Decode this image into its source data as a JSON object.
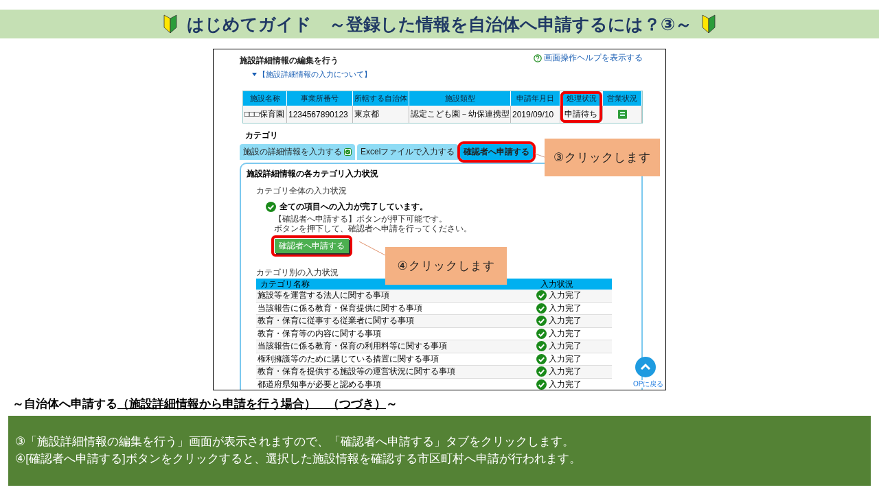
{
  "title": {
    "text": "はじめてガイド　～登録した情報を自治体へ申請するには？③～"
  },
  "screenshot": {
    "page_title": "施設詳細情報の編集を行う",
    "help_link": "画面操作ヘルプを表示する",
    "info_toggle": "【施設詳細情報の入力について】",
    "facility_table": {
      "columns": [
        {
          "label": "施設名称",
          "highlighted": false
        },
        {
          "label": "事業所番号",
          "highlighted": false
        },
        {
          "label": "所轄する自治体",
          "highlighted": false
        },
        {
          "label": "施設類型",
          "highlighted": false
        },
        {
          "label": "申請年月日",
          "highlighted": false
        },
        {
          "label": "処理状況",
          "highlighted": true
        },
        {
          "label": "営業状況",
          "highlighted": false
        }
      ],
      "rows": [
        {
          "cells": [
            "□□□保育園",
            "1234567890123",
            "東京都",
            "認定こども園－幼保連携型",
            "2019/09/10",
            "申請待ち"
          ]
        }
      ]
    },
    "category_heading": "カテゴリ",
    "tabs": [
      {
        "label": "施設の詳細情報を入力する",
        "selected": false,
        "completed": true,
        "highlighted": false
      },
      {
        "label": "Excelファイルで入力する",
        "selected": false,
        "completed": false,
        "highlighted": false
      },
      {
        "label": "確認者へ申請する",
        "selected": true,
        "completed": false,
        "highlighted": true
      }
    ],
    "panel": {
      "title": "施設詳細情報の各カテゴリ入力状況",
      "overall_label": "カテゴリ全体の入力状況",
      "complete_message": "全ての項目への入力が完了しています。",
      "notes": [
        "【確認者へ申請する】ボタンが押下可能です。",
        "ボタンを押下して、確認者へ申請を行ってください。"
      ],
      "submit_button": {
        "label": "確認者へ申請する",
        "highlighted": true
      },
      "per_category_label": "カテゴリ別の入力状況",
      "columns": [
        "カテゴリ名称",
        "入力状況"
      ],
      "rows": [
        {
          "name": "施設等を運営する法人に関する事項",
          "status": "入力完了"
        },
        {
          "name": "当該報告に係る教育・保育提供に関する事項",
          "status": "入力完了"
        },
        {
          "name": "教育・保育に従事する従業者に関する事項",
          "status": "入力完了"
        },
        {
          "name": "教育・保育等の内容に関する事項",
          "status": "入力完了"
        },
        {
          "name": "当該報告に係る教育・保育の利用料等に関する事項",
          "status": "入力完了"
        },
        {
          "name": "権利擁護等のために講じている措置に関する事項",
          "status": "入力完了"
        },
        {
          "name": "教育・保育を提供する施設等の運営状況に関する事項",
          "status": "入力完了"
        },
        {
          "name": "都道府県知事が必要と認める事項",
          "status": "入力完了"
        }
      ]
    },
    "top_link": "OPに戻る"
  },
  "callouts": [
    {
      "text": "③クリックします"
    },
    {
      "text": "④クリックします"
    }
  ],
  "section_heading": {
    "prefix": "～自治体へ申請する",
    "underlined": "（施設詳細情報から申請を行う場合）　（つづき）",
    "suffix": "～"
  },
  "instructions": [
    "③「施設詳細情報の編集を行う」画面が表示されますので、「確認者へ申請する」タブをクリックします。",
    "④[確認者へ申請する]ボタンをクリックすると、選択した施設情報を確認する市区町村へ申請が行われます。"
  ]
}
